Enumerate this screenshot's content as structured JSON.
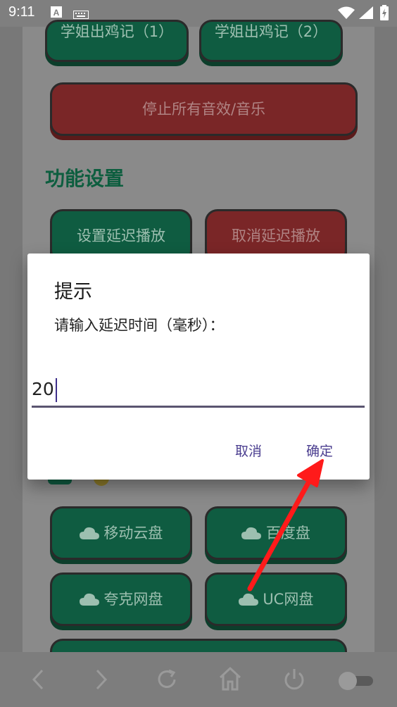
{
  "status_bar": {
    "time": "9:11",
    "icons": [
      "a-keyboard-icon",
      "keyboard-icon",
      "wifi-icon",
      "signal-icon",
      "battery-icon"
    ]
  },
  "background_app": {
    "top_buttons": [
      "学姐出鸡记（1）",
      "学姐出鸡记（2）"
    ],
    "stop_button": "停止所有音效/音乐",
    "section_title": "功能设置",
    "delay_buttons": [
      "设置延迟播放",
      "取消延迟播放"
    ],
    "disk_buttons": [
      "移动云盘",
      "百度盘",
      "夸克网盘",
      "UC网盘"
    ]
  },
  "dialog": {
    "title": "提示",
    "message": "请输入延迟时间（毫秒）：",
    "input_value": "20",
    "cancel_label": "取消",
    "ok_label": "确定"
  },
  "colors": {
    "green_button": "#0f5c41",
    "red_button": "#7a2627",
    "accent": "#4a3d8f",
    "arrow": "#ff1a1a"
  }
}
